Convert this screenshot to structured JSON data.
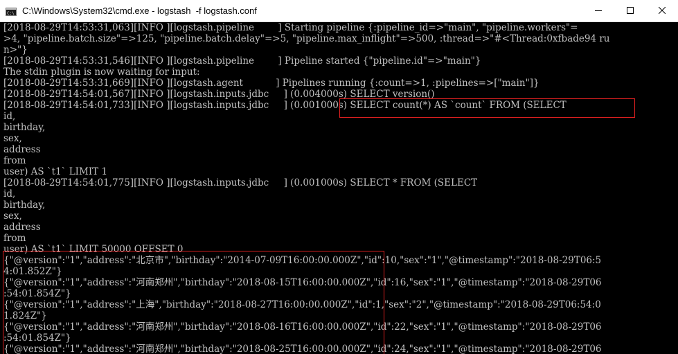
{
  "window": {
    "title": "C:\\Windows\\System32\\cmd.exe - logstash  -f logstash.conf",
    "icon": "cmd-icon",
    "controls": [
      "minimize-icon",
      "maximize-icon",
      "close-icon"
    ]
  },
  "terminal": {
    "lines": [
      "[2018-08-29T14:53:31,063][INFO ][logstash.pipeline        ] Starting pipeline {:pipeline_id=>\"main\", \"pipeline.workers\"=",
      ">4, \"pipeline.batch.size\"=>125, \"pipeline.batch.delay\"=>5, \"pipeline.max_inflight\"=>500, :thread=>\"#<Thread:0xfbade94 ru",
      "n>\"}",
      "[2018-08-29T14:53:31,546][INFO ][logstash.pipeline        ] Pipeline started {\"pipeline.id\"=>\"main\"}",
      "The stdin plugin is now waiting for input:",
      "[2018-08-29T14:53:31,669][INFO ][logstash.agent           ] Pipelines running {:count=>1, :pipelines=>[\"main\"]}",
      "[2018-08-29T14:54:01,567][INFO ][logstash.inputs.jdbc     ] (0.004000s) SELECT version()",
      "[2018-08-29T14:54:01,733][INFO ][logstash.inputs.jdbc     ] (0.001000s) SELECT count(*) AS `count` FROM (SELECT",
      "id,",
      "birthday,",
      "sex,",
      "address",
      "from",
      "user) AS `t1` LIMIT 1",
      "[2018-08-29T14:54:01,775][INFO ][logstash.inputs.jdbc     ] (0.001000s) SELECT * FROM (SELECT",
      "id,",
      "birthday,",
      "sex,",
      "address",
      "from",
      "user) AS `t1` LIMIT 50000 OFFSET 0",
      "{\"@version\":\"1\",\"address\":\"北京市\",\"birthday\":\"2014-07-09T16:00:00.000Z\",\"id\":10,\"sex\":\"1\",\"@timestamp\":\"2018-08-29T06:5",
      "4:01.852Z\"}",
      "{\"@version\":\"1\",\"address\":\"河南郑州\",\"birthday\":\"2018-08-15T16:00:00.000Z\",\"id\":16,\"sex\":\"1\",\"@timestamp\":\"2018-08-29T06",
      ":54:01.854Z\"}",
      "{\"@version\":\"1\",\"address\":\"上海\",\"birthday\":\"2018-08-27T16:00:00.000Z\",\"id\":1,\"sex\":\"2\",\"@timestamp\":\"2018-08-29T06:54:0",
      "1.824Z\"}",
      "{\"@version\":\"1\",\"address\":\"河南郑州\",\"birthday\":\"2018-08-16T16:00:00.000Z\",\"id\":22,\"sex\":\"1\",\"@timestamp\":\"2018-08-29T06",
      ":54:01.854Z\"}",
      "{\"@version\":\"1\",\"address\":\"河南郑州\",\"birthday\":\"2018-08-25T16:00:00.000Z\",\"id\":24,\"sex\":\"1\",\"@timestamp\":\"2018-08-29T06"
    ]
  },
  "colors": {
    "terminal_bg": "#000000",
    "terminal_fg": "#c0c0c0",
    "titlebar_bg": "#ffffff",
    "annotation_red": "#e02020"
  }
}
